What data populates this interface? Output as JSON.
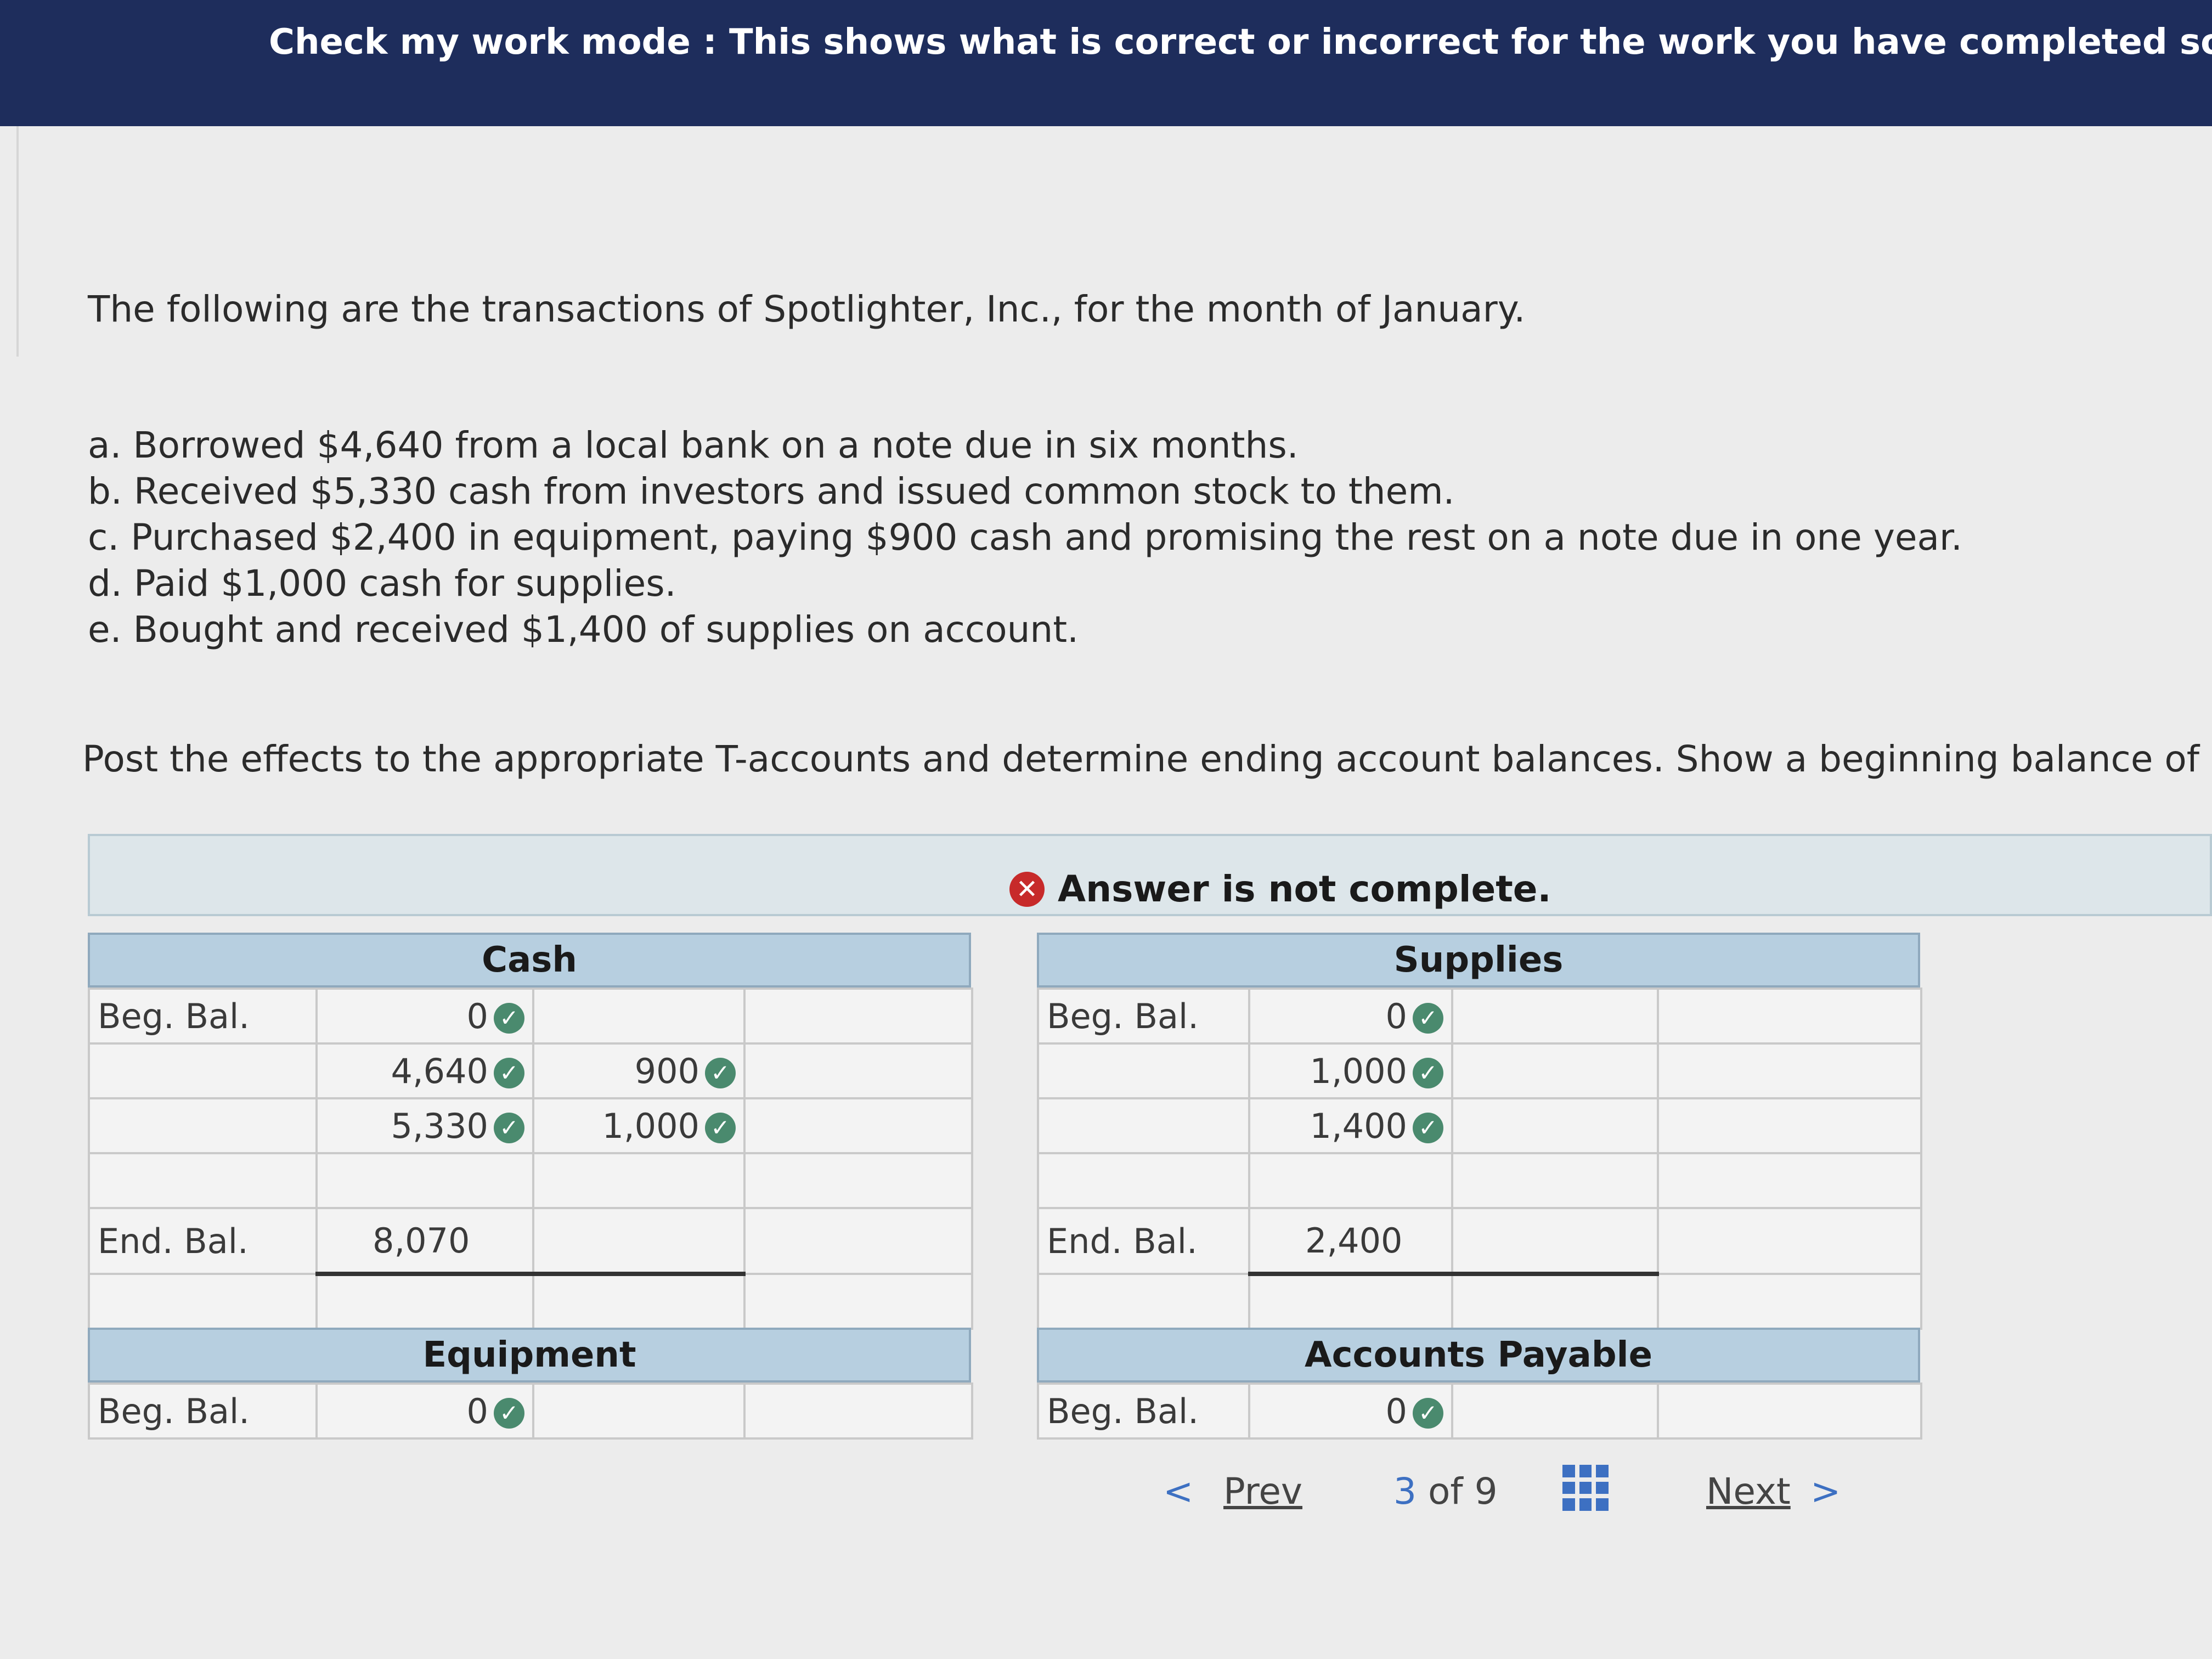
{
  "banner": {
    "text": "Check my work mode : This shows what is correct or incorrect for the work you have completed so far. It does not"
  },
  "question": {
    "intro": "The following are the transactions of Spotlighter, Inc., for the month of January.",
    "transactions": [
      "a. Borrowed $4,640 from a local bank on a note due in six months.",
      "b. Received $5,330 cash from investors and issued common stock to them.",
      "c. Purchased $2,400 in equipment, paying $900 cash and promising the rest on a note due in one year.",
      "d. Paid $1,000 cash for supplies.",
      "e. Bought and received $1,400 of supplies on account."
    ],
    "instruction": "Post the effects to the appropriate T-accounts and determine ending account balances. Show a beginning balance of zero."
  },
  "notice": {
    "icon": "x-icon",
    "text": "Answer is not complete."
  },
  "accounts": {
    "cash": {
      "title": "Cash",
      "beg_label": "Beg. Bal.",
      "beg_debit": "0",
      "debits": [
        "4,640",
        "5,330"
      ],
      "credits": [
        "900",
        "1,000"
      ],
      "end_label": "End. Bal.",
      "end_debit": "8,070"
    },
    "supplies": {
      "title": "Supplies",
      "beg_label": "Beg. Bal.",
      "beg_debit": "0",
      "debits": [
        "1,000",
        "1,400"
      ],
      "end_label": "End. Bal.",
      "end_debit": "2,400"
    },
    "equipment": {
      "title": "Equipment",
      "beg_label": "Beg. Bal.",
      "beg_debit": "0"
    },
    "accounts_payable": {
      "title": "Accounts Payable",
      "beg_label": "Beg. Bal.",
      "beg_debit": "0"
    }
  },
  "pagination": {
    "prev_label": "Prev",
    "current": "3",
    "of_label": "of 9",
    "next_label": "Next"
  },
  "colors": {
    "banner": "#1e2d5c",
    "check": "#4a8a6e",
    "error": "#c72a2a",
    "link": "#3d70c2",
    "account_header": "#b7cfe0"
  }
}
